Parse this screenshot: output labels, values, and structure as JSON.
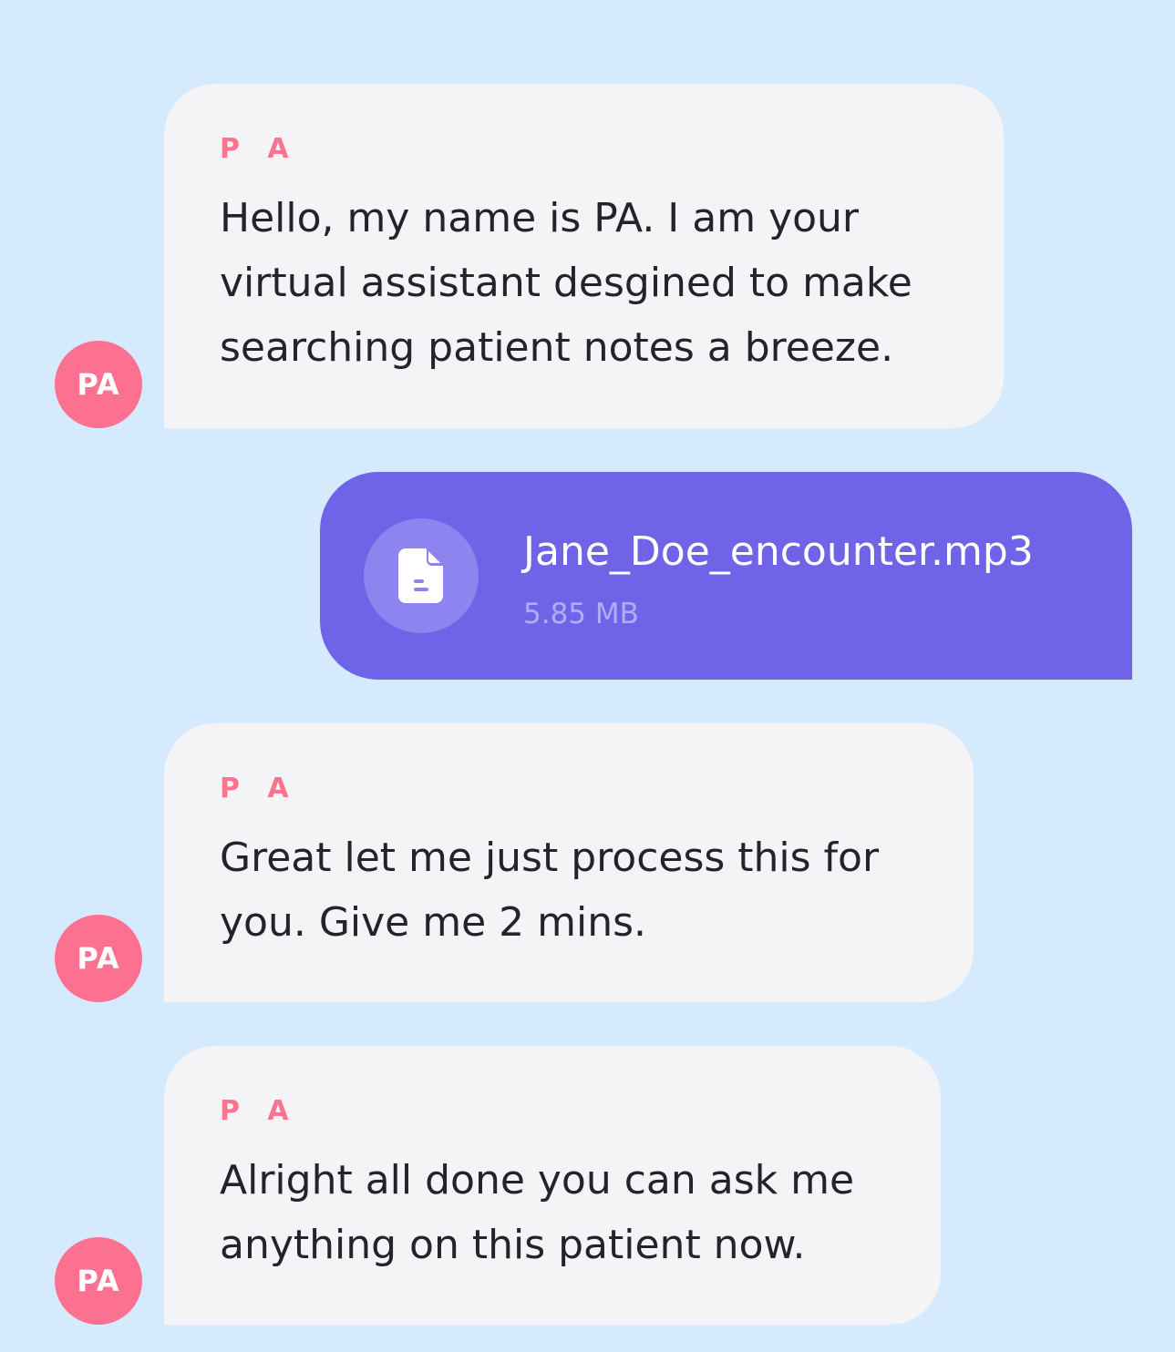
{
  "colors": {
    "background": "#d5eafd",
    "bot_bubble": "#f4f4f7",
    "user_bubble": "#6f63e8",
    "accent_pink": "#fd7190",
    "text_dark": "#24232b"
  },
  "messages": [
    {
      "sender": "P A",
      "avatar": "PA",
      "lines": [
        "Hello, my name is PA. I am your",
        "virtual assistant desgined to make",
        "searching patient notes a breeze."
      ]
    },
    {
      "type": "file",
      "icon": "document-icon",
      "file_name": "Jane_Doe_encounter.mp3",
      "file_size": "5.85 MB"
    },
    {
      "sender": "P A",
      "avatar": "PA",
      "lines": [
        "Great let me just process this for",
        "you. Give me 2 mins."
      ]
    },
    {
      "sender": "P A",
      "avatar": "PA",
      "lines": [
        "Alright all done you can ask me",
        "anything on this patient now."
      ]
    }
  ]
}
